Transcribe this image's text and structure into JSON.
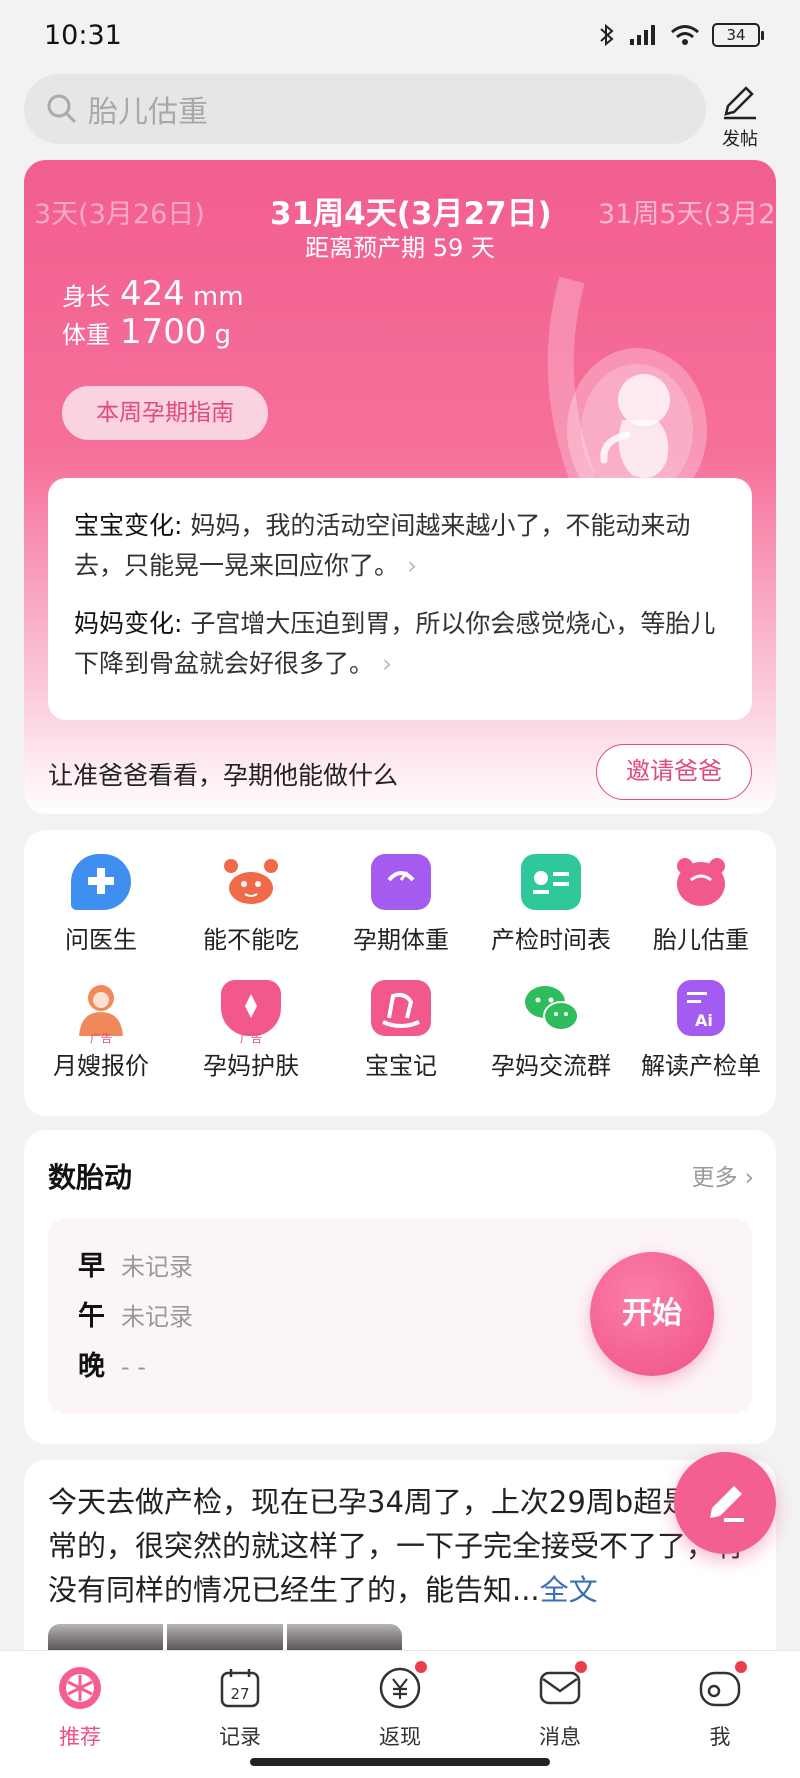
{
  "status_bar": {
    "time": "10:31",
    "battery": "34"
  },
  "search": {
    "placeholder": "胎儿估重",
    "post_label": "发帖"
  },
  "pregnancy": {
    "prev_day": "3天(3月26日)",
    "current_day": "31周4天(3月27日)",
    "next_day": "31周5天(3月2",
    "due_text": "距离预产期 59 天",
    "length_label": "身长",
    "length_value": "424",
    "length_unit": "mm",
    "weight_label": "体重",
    "weight_value": "1700",
    "weight_unit": "g",
    "guide_button": "本周孕期指南",
    "baby_change_label": "宝宝变化:",
    "baby_change_text": " 妈妈，我的活动空间越来越小了，不能动来动去，只能晃一晃来回应你了。",
    "mom_change_label": "妈妈变化:",
    "mom_change_text": " 子宫增大压迫到胃，所以你会感觉烧心，等胎儿下降到骨盆就会好很多了。",
    "invite_text": "让准爸爸看看，孕期他能做什么",
    "invite_button": "邀请爸爸"
  },
  "tools": [
    {
      "label": "问医生",
      "icon": "doctor-chat-icon",
      "color": "#3e8ff0"
    },
    {
      "label": "能不能吃",
      "icon": "crab-icon",
      "color": "#f06a4a"
    },
    {
      "label": "孕期体重",
      "icon": "scale-icon",
      "color": "#a45cf0"
    },
    {
      "label": "产检时间表",
      "icon": "schedule-icon",
      "color": "#2ec89a"
    },
    {
      "label": "胎儿估重",
      "icon": "bear-icon",
      "color": "#f2588e"
    },
    {
      "label": "月嫂报价",
      "icon": "nanny-icon",
      "color": "#f08a5a",
      "ad": "广告"
    },
    {
      "label": "孕妈护肤",
      "icon": "skincare-icon",
      "color": "#f2588e",
      "ad": "广告"
    },
    {
      "label": "宝宝记",
      "icon": "rocking-horse-icon",
      "color": "#f2588e"
    },
    {
      "label": "孕妈交流群",
      "icon": "wechat-icon",
      "color": "#2ebd5a"
    },
    {
      "label": "解读产检单",
      "icon": "ai-report-icon",
      "color": "#a45cf0"
    }
  ],
  "fetal_movement": {
    "title": "数胎动",
    "more": "更多",
    "morning_label": "早",
    "morning_value": "未记录",
    "noon_label": "午",
    "noon_value": "未记录",
    "evening_label": "晚",
    "evening_value": "- -",
    "start_button": "开始"
  },
  "post": {
    "text": "今天去做产检，现在已孕34周了，上次29周b超是正常的，很突然的就这样了，一下子完全接受不了了，有没有同样的情况已经生了的，能告知...",
    "full_link": "全文"
  },
  "tabs": [
    {
      "label": "推荐",
      "icon": "home-icon",
      "active": true
    },
    {
      "label": "记录",
      "icon": "calendar-icon",
      "date": "27"
    },
    {
      "label": "返现",
      "icon": "yuan-icon",
      "badge": true
    },
    {
      "label": "消息",
      "icon": "message-icon",
      "badge": true
    },
    {
      "label": "我",
      "icon": "profile-icon",
      "badge": true
    }
  ]
}
